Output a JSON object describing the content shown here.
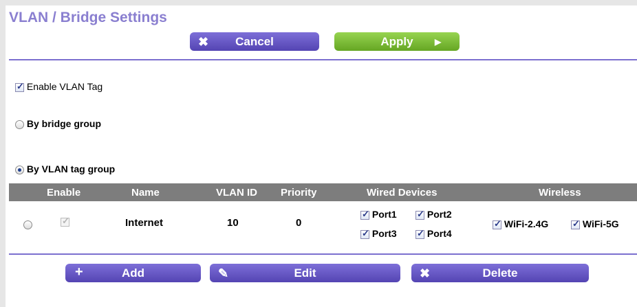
{
  "page": {
    "title": "VLAN / Bridge Settings"
  },
  "top_buttons": {
    "cancel": "Cancel",
    "apply": "Apply"
  },
  "enable_vlan_tag": {
    "label": "Enable VLAN Tag",
    "checked": true
  },
  "modes": [
    {
      "label": "By bridge group",
      "selected": false
    },
    {
      "label": "By VLAN tag group",
      "selected": true
    }
  ],
  "table": {
    "headers": [
      "Enable",
      "Name",
      "VLAN ID",
      "Priority",
      "Wired Devices",
      "Wireless"
    ],
    "rows": [
      {
        "name": "Internet",
        "vlan_id": "10",
        "priority": "0",
        "wired": [
          "Port1",
          "Port2",
          "Port3",
          "Port4"
        ],
        "wireless": [
          "WiFi-2.4G",
          "WiFi-5G"
        ]
      }
    ]
  },
  "bottom_buttons": {
    "add": "Add",
    "edit": "Edit",
    "delete": "Delete"
  },
  "colors": {
    "accent": "#7b6fcf",
    "title": "#8a7fd0",
    "apply": "#7fc23a",
    "header_bg": "#7d7d7d"
  }
}
